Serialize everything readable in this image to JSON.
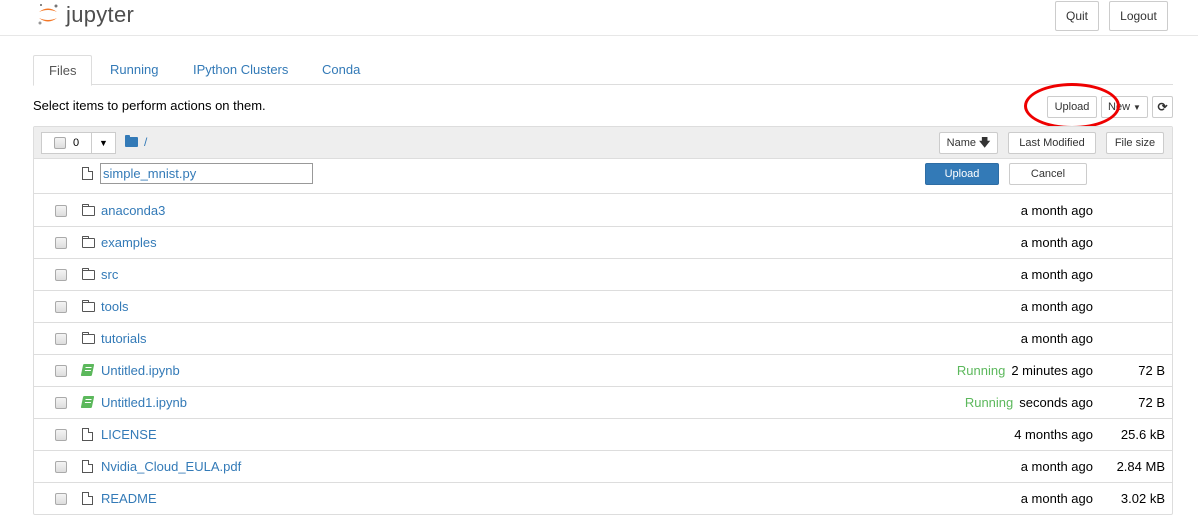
{
  "header": {
    "logo_text": "jupyter",
    "quit_label": "Quit",
    "logout_label": "Logout"
  },
  "tabs": [
    {
      "label": "Files",
      "active": true
    },
    {
      "label": "Running",
      "active": false
    },
    {
      "label": "IPython Clusters",
      "active": false
    },
    {
      "label": "Conda",
      "active": false
    }
  ],
  "toolbar": {
    "hint": "Select items to perform actions on them.",
    "upload_label": "Upload",
    "new_label": "New",
    "refresh_icon": "refresh-icon"
  },
  "list_header": {
    "selected_count": "0",
    "breadcrumb": "/",
    "sort_name_label": "Name",
    "sort_modified_label": "Last Modified",
    "sort_size_label": "File size"
  },
  "upload_row": {
    "filename": "simple_mnist.py",
    "upload_label": "Upload",
    "cancel_label": "Cancel"
  },
  "items": [
    {
      "type": "folder",
      "name": "anaconda3",
      "status": "",
      "modified": "a month ago",
      "size": ""
    },
    {
      "type": "folder",
      "name": "examples",
      "status": "",
      "modified": "a month ago",
      "size": ""
    },
    {
      "type": "folder",
      "name": "src",
      "status": "",
      "modified": "a month ago",
      "size": ""
    },
    {
      "type": "folder",
      "name": "tools",
      "status": "",
      "modified": "a month ago",
      "size": ""
    },
    {
      "type": "folder",
      "name": "tutorials",
      "status": "",
      "modified": "a month ago",
      "size": ""
    },
    {
      "type": "notebook",
      "name": "Untitled.ipynb",
      "status": "Running",
      "modified": "2 minutes ago",
      "size": "72 B"
    },
    {
      "type": "notebook",
      "name": "Untitled1.ipynb",
      "status": "Running",
      "modified": "seconds ago",
      "size": "72 B"
    },
    {
      "type": "file",
      "name": "LICENSE",
      "status": "",
      "modified": "4 months ago",
      "size": "25.6 kB"
    },
    {
      "type": "file",
      "name": "Nvidia_Cloud_EULA.pdf",
      "status": "",
      "modified": "a month ago",
      "size": "2.84 MB"
    },
    {
      "type": "file",
      "name": "README",
      "status": "",
      "modified": "a month ago",
      "size": "3.02 kB"
    }
  ],
  "colors": {
    "link": "#337ab7",
    "running": "#5cb85c",
    "annotation_circle": "#ee0000"
  }
}
